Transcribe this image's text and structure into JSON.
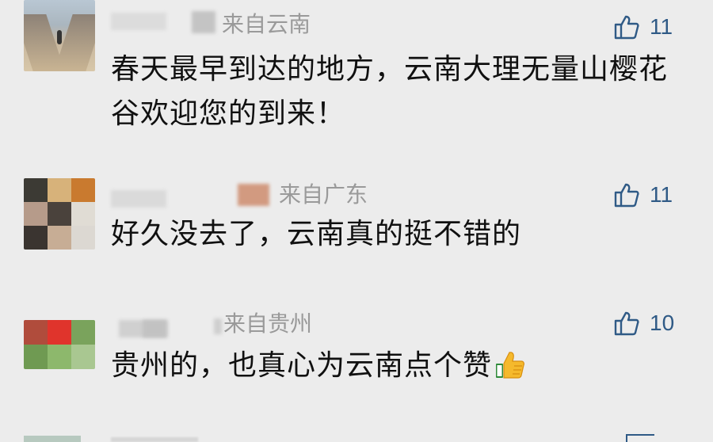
{
  "comments": [
    {
      "location": "来自云南",
      "likes": "11",
      "text": "春天最早到达的地方，云南大理无量山樱花谷欢迎您的到来！"
    },
    {
      "location": "来自广东",
      "likes": "11",
      "text": "好久没去了，云南真的挺不错的"
    },
    {
      "location": "来自贵州",
      "likes": "10",
      "text": "贵州的，也真心为云南点个赞",
      "emoji": "thumbs-up-emoji"
    }
  ],
  "icons": {
    "like": "thumbs-up-icon"
  },
  "colors": {
    "background": "#ececec",
    "text": "#101010",
    "location": "#9a9a9a",
    "like_icon": "#2f5a86"
  }
}
